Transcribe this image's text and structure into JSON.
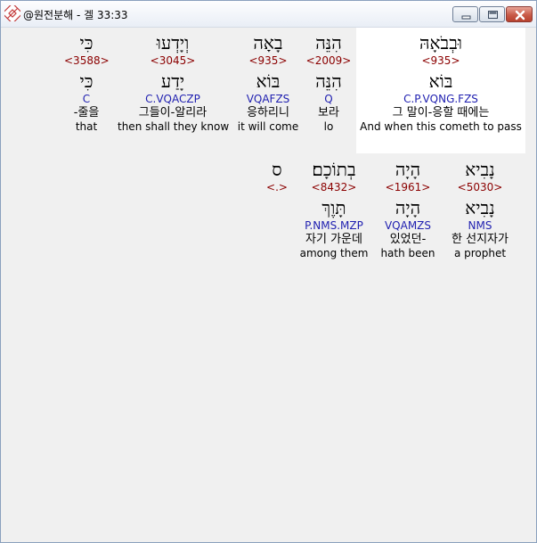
{
  "window": {
    "title": "@원전분해 - 겔 33:33",
    "buttons": [
      "minimize-icon",
      "maximize-icon",
      "close-icon"
    ],
    "close_color": "#c85a47"
  },
  "colors": {
    "strong": "#8b0000",
    "morph": "#1f1fb0",
    "highlight_bg": "#ffffff"
  },
  "rows": [
    {
      "words": [
        {
          "heb": "וּבְבֹאָהּ",
          "strong": "<935>",
          "lemma": "בּוֹא",
          "morph": "C.P.VQNG.FZS",
          "kor": "그 말이-응할 때에는",
          "eng": "And when this cometh to pass",
          "highlighted": true
        },
        {
          "heb": "הִנֵּה",
          "strong": "<2009>",
          "lemma": "הִנֵּה",
          "morph": "Q",
          "kor": "보라",
          "eng": "lo"
        },
        {
          "heb": "בָאָה",
          "strong": "<935>",
          "lemma": "בּוֹא",
          "morph": "VQAFZS",
          "kor": "응하리니",
          "eng": "it will come"
        },
        {
          "heb": "וְיָדְעוּ",
          "strong": "<3045>",
          "lemma": "יָדַע",
          "morph": "C.VQACZP",
          "kor": "그들이-알리라",
          "eng": "then shall they know"
        },
        {
          "heb": "כִּי",
          "strong": "<3588>",
          "lemma": "כִּי",
          "morph": "C",
          "kor": "-줄을",
          "eng": "that"
        }
      ]
    },
    {
      "words": [
        {
          "heb": "נָבִיא",
          "strong": "<5030>",
          "lemma": "נָבִיא",
          "morph": "NMS",
          "kor": "한 선지자가",
          "eng": "a prophet"
        },
        {
          "heb": "הָיָה",
          "strong": "<1961>",
          "lemma": "הָיָה",
          "morph": "VQAMZS",
          "kor": "있었던-",
          "eng": "hath been"
        },
        {
          "heb": "בְתוֹכָם׃",
          "strong": "<8432>",
          "lemma": "תָּוֶךְ",
          "morph": "P.NMS.MZP",
          "kor": "자기 가운데",
          "eng": "among them"
        },
        {
          "heb": "ס",
          "strong": "<.>",
          "lemma": "",
          "morph": "",
          "kor": "",
          "eng": ""
        }
      ]
    }
  ]
}
